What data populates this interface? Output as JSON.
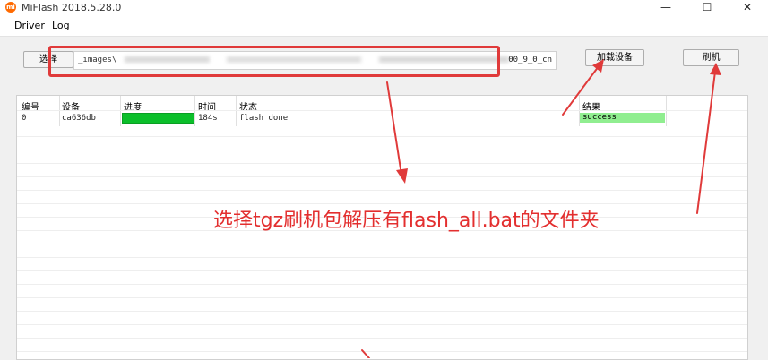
{
  "window": {
    "title": "MiFlash 2018.5.28.0",
    "app_icon_glyph": "mi",
    "minimize_glyph": "—",
    "maximize_glyph": "☐",
    "close_glyph": "✕"
  },
  "menu": {
    "driver": "Driver",
    "log": "Log"
  },
  "toolbar": {
    "select_label": "选择",
    "path_prefix": "_images\\",
    "path_suffix": "00_9_0_cn",
    "load_device_label": "加载设备",
    "flash_label": "刷机"
  },
  "table": {
    "headers": [
      "编号",
      "设备",
      "进度",
      "时间",
      "状态",
      "结果"
    ],
    "rows": [
      {
        "id": "0",
        "device": "ca636db",
        "progress": 1.0,
        "time": "184s",
        "status": "flash done",
        "result": "success"
      }
    ]
  },
  "annotation": {
    "text": "选择tgz刷机包解压有flash_all.bat的文件夹",
    "color": "#e32f2f"
  },
  "colors": {
    "accent_red": "#e03a3a",
    "progress_green": "#0bbf2a",
    "success_green": "#90ee90",
    "app_icon": "#ff6a00"
  }
}
